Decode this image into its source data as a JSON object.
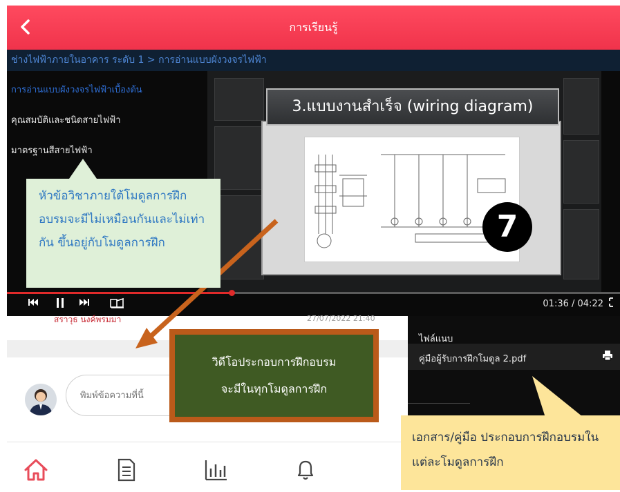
{
  "header": {
    "title": "การเรียนรู้",
    "back_icon": "chevron-left-icon",
    "color": "#f0334b"
  },
  "breadcrumb": "ช่างไฟฟ้าภายในอาคาร ระดับ 1 > การอ่านแบบผังวงจรไฟฟ้า",
  "lessons": [
    {
      "label": "การอ่านแบบผังวงจรไฟฟ้าเบื้องต้น",
      "active": true,
      "color": "#2f6fd6"
    },
    {
      "label": "คุณสมบัติและชนิดสายไฟฟ้า",
      "active": false
    },
    {
      "label": "มาตรฐานสีสายไฟฟ้า",
      "active": false
    }
  ],
  "video": {
    "slide_title": "3.แบบงานสำเร็จ (wiring diagram)",
    "slide_number": "7",
    "time": "01:36 / 04:22",
    "progress": 0.366,
    "controls": [
      "previous-icon",
      "pause-icon",
      "next-icon",
      "subtitle-icon",
      "fullscreen-icon"
    ]
  },
  "comment": {
    "author": "สราวุธ นงค์พรมมา",
    "timestamp": "27/07/2022 21:40",
    "input_placeholder": "พิมพ์ข้อความที่นี้"
  },
  "files": {
    "title": "ไฟล์แนบ",
    "items": [
      {
        "name": "คู่มือผู้รับการฝึกโมดูล 2.pdf",
        "icon": "printer-icon"
      }
    ]
  },
  "nav": {
    "items": [
      "home-icon",
      "document-icon",
      "chart-icon",
      "bell-icon"
    ],
    "active_color": "#e84c5a"
  },
  "callouts": {
    "topics": "หัวข้อวิชาภายใต้โมดูลการฝึกอบรมจะมีไม่เหมือนกันและไม่เท่ากัน ขึ้นอยู่กับโมดูลการฝึก",
    "video_line1": "วิดีโอประกอบการฝึกอบรม",
    "video_line2": "จะมีในทุกโมดูลการฝึก",
    "documents": "เอกสาร/คู่มือ ประกอบการฝึกอบรมในแต่ละโมดูลการฝึก"
  }
}
